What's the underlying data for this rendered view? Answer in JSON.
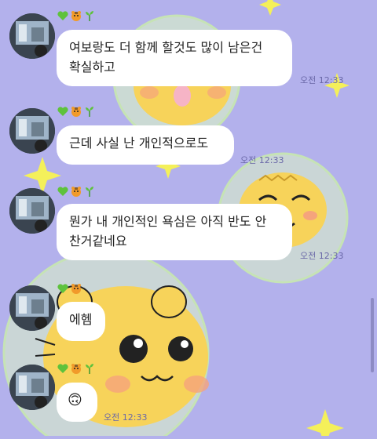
{
  "chat": {
    "messages": [
      {
        "text": "여보랑도 더 함께 할것도 많이 남은건\n확실하고",
        "time": "오전 12:33"
      },
      {
        "text": "근데 사실 난 개인적으로도",
        "time": "오전 12:33"
      },
      {
        "text": "뭔가 내 개인적인 욕심은 아직 반도 안\n찬거같네요",
        "time": "오전 12:33"
      },
      {
        "text": "에헴",
        "time": ""
      },
      {
        "text": "🙃",
        "time": "오전 12:33"
      }
    ],
    "sender_name_icons": [
      "green-heart-icon",
      "tiger-icon",
      "sprout-icon"
    ]
  },
  "colors": {
    "background": "#b3b1ec",
    "bubble": "#ffffff",
    "tiger": "#f7d35a",
    "sparkle": "#f4f05a"
  }
}
